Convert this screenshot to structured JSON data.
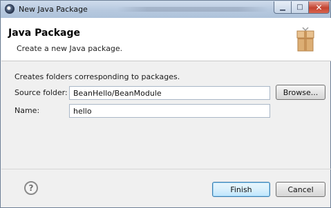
{
  "window": {
    "title": "New Java Package"
  },
  "header": {
    "title": "Java Package",
    "description": "Create a new Java package."
  },
  "body": {
    "description": "Creates folders corresponding to packages.",
    "source_folder_label": "Source folder:",
    "source_folder_value": "BeanHello/BeanModule",
    "name_label": "Name:",
    "name_value": "hello"
  },
  "buttons": {
    "browse": "Browse...",
    "finish": "Finish",
    "cancel": "Cancel",
    "help": "?"
  },
  "icons": {
    "app": "eclipse-icon",
    "banner": "package-box-icon",
    "help": "help-icon"
  },
  "colors": {
    "titlebar": "#b7c9df",
    "close_button": "#c4432f",
    "dialog_bg": "#f0f0f0",
    "default_button_border": "#3c7fb1"
  }
}
